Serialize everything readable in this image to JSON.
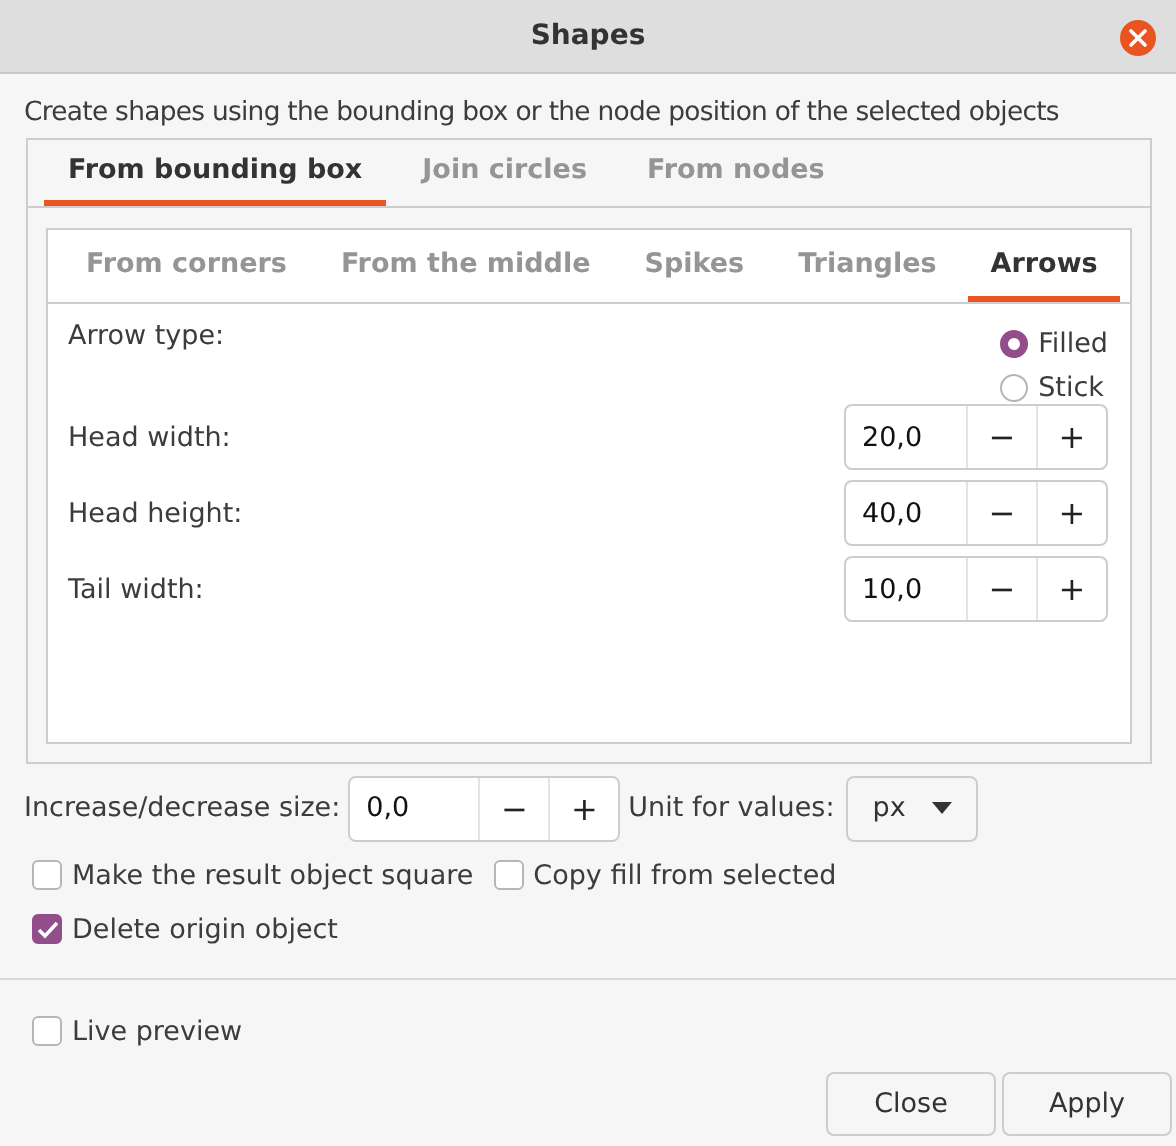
{
  "window": {
    "title": "Shapes"
  },
  "description": "Create shapes using the bounding box or the node position of the selected objects",
  "tabs": [
    {
      "label": "From bounding box",
      "selected": true
    },
    {
      "label": "Join circles",
      "selected": false
    },
    {
      "label": "From nodes",
      "selected": false
    }
  ],
  "subtabs": [
    {
      "label": "From corners",
      "selected": false
    },
    {
      "label": "From the middle",
      "selected": false
    },
    {
      "label": "Spikes",
      "selected": false
    },
    {
      "label": "Triangles",
      "selected": false
    },
    {
      "label": "Arrows",
      "selected": true
    }
  ],
  "arrow_type": {
    "label": "Arrow type:",
    "options": [
      {
        "label": "Filled",
        "selected": true
      },
      {
        "label": "Stick",
        "selected": false
      }
    ]
  },
  "fields": [
    {
      "label": "Head width:",
      "value": "20,0",
      "decrement": "−",
      "increment": "+"
    },
    {
      "label": "Head height:",
      "value": "40,0",
      "decrement": "−",
      "increment": "+"
    },
    {
      "label": "Tail width:",
      "value": "10,0",
      "decrement": "−",
      "increment": "+"
    }
  ],
  "size": {
    "label": "Increase/decrease size:",
    "value": "0,0",
    "decrement": "−",
    "increment": "+"
  },
  "unit": {
    "label": "Unit for values:",
    "value": "px"
  },
  "options": [
    {
      "label": "Make the result object square",
      "checked": false
    },
    {
      "label": "Copy fill from selected",
      "checked": false
    },
    {
      "label": "Delete origin object",
      "checked": true
    }
  ],
  "live_preview": {
    "label": "Live preview",
    "checked": false
  },
  "buttons": [
    "Close",
    "Apply"
  ]
}
